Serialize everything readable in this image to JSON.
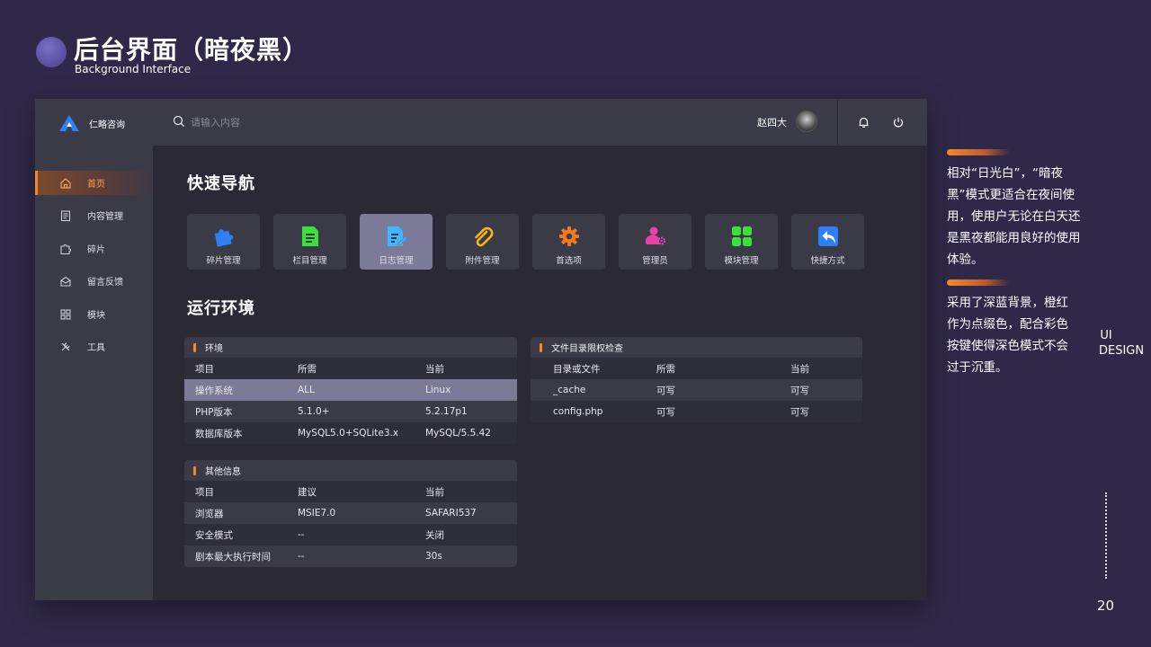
{
  "slide": {
    "title": "后台界面（暗夜黑）",
    "subtitle": "Background Interface",
    "description_1": "相对“日光白”，“暗夜黑”模式更适合在夜间使用，使用户无论在白天还是黑夜都能用良好的使用体验。",
    "description_2": "采用了深蓝背景，橙红作为点缀色，配合彩色按键使得深色模式不会过于沉重。",
    "ui_design": "UI DESIGN",
    "page_number": "20"
  },
  "app": {
    "logo_text": "仁略咨询",
    "search_placeholder": "请输入内容",
    "user_name": "赵四大",
    "sidebar": [
      {
        "label": "首页",
        "icon": "home-icon",
        "active": true
      },
      {
        "label": "内容管理",
        "icon": "content-icon",
        "active": false
      },
      {
        "label": "碎片",
        "icon": "puzzle-icon",
        "active": false
      },
      {
        "label": "留言反馈",
        "icon": "message-icon",
        "active": false
      },
      {
        "label": "模块",
        "icon": "grid-icon",
        "active": false
      },
      {
        "label": "工具",
        "icon": "tools-icon",
        "active": false
      }
    ],
    "quick_nav_title": "快速导航",
    "quick_nav": [
      {
        "label": "碎片管理",
        "icon": "puzzle-icon",
        "color": "#2f7ff7"
      },
      {
        "label": "栏目管理",
        "icon": "document-icon",
        "color": "#3ce03c"
      },
      {
        "label": "日志管理",
        "icon": "log-edit-icon",
        "color": "#3fb6ff"
      },
      {
        "label": "附件管理",
        "icon": "paperclip-icon",
        "color": "#f7b51c"
      },
      {
        "label": "首选项",
        "icon": "gear-icon",
        "color": "#f07a1c"
      },
      {
        "label": "管理员",
        "icon": "admin-icon",
        "color": "#e642a8"
      },
      {
        "label": "模块管理",
        "icon": "modules-icon",
        "color": "#3ce03c"
      },
      {
        "label": "快捷方式",
        "icon": "shortcut-icon",
        "color": "#2f7ff7"
      }
    ],
    "runtime_title": "运行环境",
    "env_card": {
      "title": "环境",
      "headers": [
        "项目",
        "所需",
        "当前"
      ],
      "rows": [
        [
          "操作系统",
          "ALL",
          "Linux"
        ],
        [
          "PHP版本",
          "5.1.0+",
          "5.2.17p1"
        ],
        [
          "数据库版本",
          "MySQL5.0+SQLite3.x",
          "MySQL/5.5.42"
        ]
      ]
    },
    "other_card": {
      "title": "其他信息",
      "headers": [
        "项目",
        "建议",
        "当前"
      ],
      "rows": [
        [
          "浏览器",
          "MSIE7.0",
          "SAFARI537"
        ],
        [
          "安全模式",
          "--",
          "关闭"
        ],
        [
          "剧本最大执行时间",
          "--",
          "30s"
        ]
      ]
    },
    "perm_card": {
      "title": "文件目录限权检查",
      "headers": [
        "目录或文件",
        "所需",
        "当前"
      ],
      "rows": [
        [
          "_cache",
          "可写",
          "可写"
        ],
        [
          "config.php",
          "可写",
          "可写"
        ]
      ]
    }
  },
  "colors": {
    "accent": "#f08a2c",
    "background": "#2f2848",
    "panel": "#3b3a47"
  }
}
